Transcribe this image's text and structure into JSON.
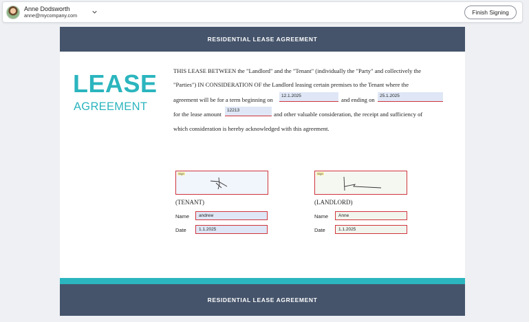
{
  "header": {
    "user_name": "Anne Dodsworth",
    "user_email": "anne@mycompany.com",
    "finish_label": "Finish Signing"
  },
  "document": {
    "band_title": "RESIDENTIAL LEASE AGREEMENT",
    "lease_word": "LEASE",
    "agreement_word": "AGREEMENT",
    "paragraph": {
      "line1": "THIS LEASE BETWEEN the \"Landlord\" and the \"Tenant\" (individually the \"Party\" and collectively the",
      "line2": "\"Parties\") IN CONSIDERATION OF the Landlord leasing certain premises to the Tenant where the",
      "line3_start": "agreement will be for a term beginning on",
      "line3_mid": "and ending on",
      "line4_start": "for the lease amount",
      "line4_end": "and other valuable consideration, the receipt and sufficiency of",
      "line5": "which consideration is hereby acknowledged with this agreement."
    },
    "fields": {
      "start_date": "12.1.2025",
      "end_date": "25.1.2025",
      "amount": "12213"
    },
    "tenant": {
      "sign_tag": "Sign",
      "role": "(TENANT)",
      "name_label": "Name",
      "name_value": "andrew",
      "date_label": "Date",
      "date_value": "1.1.2025"
    },
    "landlord": {
      "sign_tag": "Sign",
      "role": "(LANDLORD)",
      "name_label": "Name",
      "name_value": "Anne",
      "date_label": "Date",
      "date_value": "1.1.2025"
    },
    "footer_title": "RESIDENTIAL LEASE AGREEMENT"
  },
  "colors": {
    "band": "#45546b",
    "accent": "#2bb5be",
    "field_border": "#d0333b",
    "field_fill": "#dfe7f6"
  },
  "icons": {
    "user_menu": "chevron-down-icon",
    "avatar": "avatar"
  }
}
